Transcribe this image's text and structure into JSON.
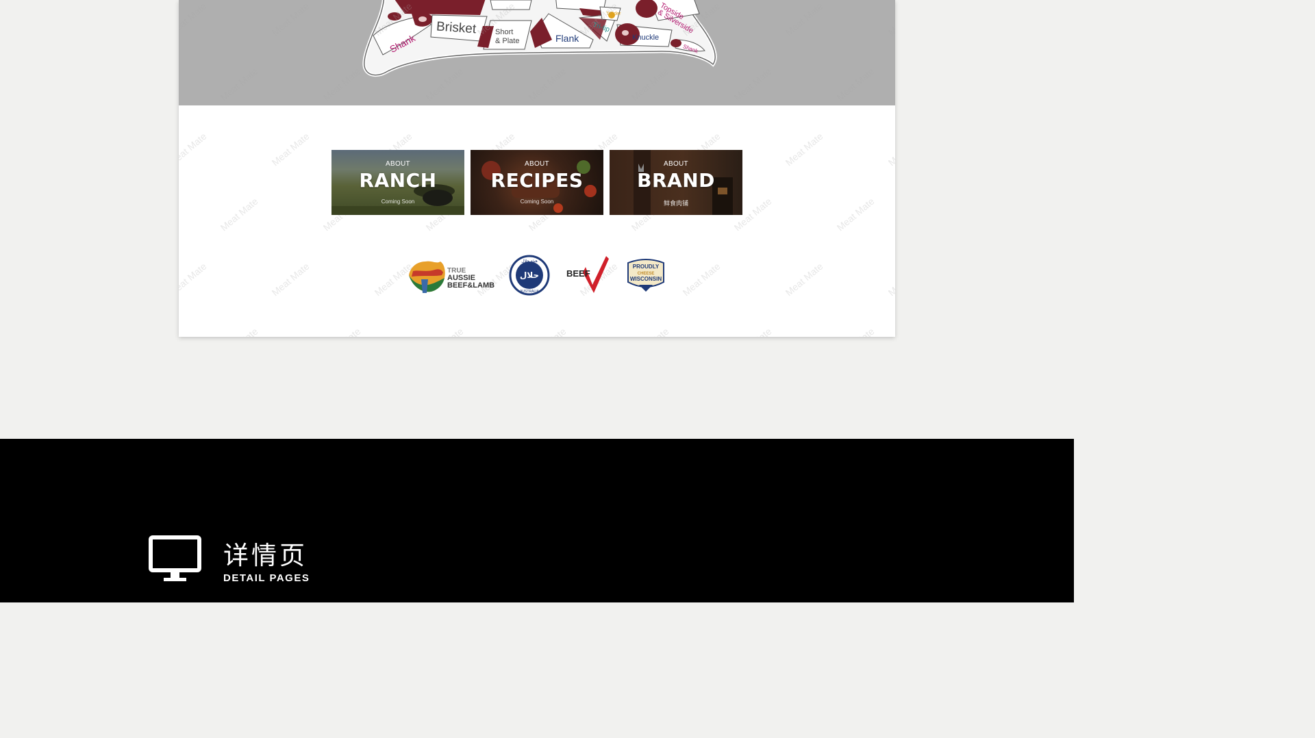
{
  "beef_chart": {
    "labels": {
      "shank": "Shank",
      "brisket": "Brisket",
      "short_plate_1": "Short",
      "short_plate_2": "& Plate",
      "flank": "Flank",
      "tri_tip": "Tri-tip",
      "tender": "Tender",
      "knuckle": "Knuckle",
      "topside_1": "Topside",
      "topside_2": "& Silverside",
      "shank_rear": "Shank"
    }
  },
  "about_cards": [
    {
      "small": "ABOUT",
      "title": "RANCH",
      "sub": "Coming Soon"
    },
    {
      "small": "ABOUT",
      "title": "RECIPES",
      "sub": "Coming Soon"
    },
    {
      "small": "ABOUT",
      "title": "BRAND",
      "sub": "鲜食肉铺"
    }
  ],
  "certifications": {
    "aussie": {
      "line1": "TRUE",
      "line2": "AUSSIE",
      "line3": "BEEF&LAMB"
    },
    "halal": {
      "top": "ﻫﻴﺌﺔ ﺣﻼﻝ",
      "center": "ﺣﻼﻝ",
      "bottom": "AUSTRALIA"
    },
    "beef": {
      "text": "BEEF"
    },
    "wisconsin": {
      "line1": "PROUDLY",
      "line2": "CHEESE",
      "line3": "WISCONSIN"
    }
  },
  "watermark_text": "Meat Mate",
  "footer": {
    "title_cn": "详情页",
    "title_en": "DETAIL PAGES"
  },
  "colors": {
    "banner_gray": "#afafaf",
    "meat_red": "#7a1f2b",
    "label_magenta": "#b2186e",
    "label_navy": "#1f3a78",
    "label_teal": "#1e8e8a"
  }
}
